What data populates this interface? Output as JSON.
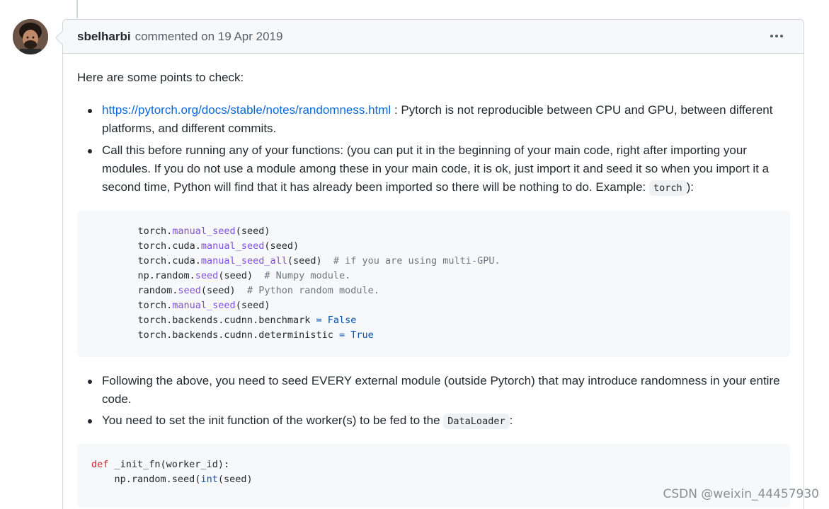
{
  "comment": {
    "author": "sbelharbi",
    "meta": "commented on 19 Apr 2019",
    "intro": "Here are some points to check:",
    "bullets": [
      {
        "link": "https://pytorch.org/docs/stable/notes/randomness.html",
        "text": " : Pytorch is not reproducible between CPU and GPU, between different platforms, and different commits."
      },
      {
        "text_before": "Call this before running any of your functions: (you can put it in the beginning of your main code, right after importing your modules. If you do not use a module among these in your main code, it is ok, just import it and seed it so when you import it a second time, Python will find that it has already been imported so there will be nothing to do. Example: ",
        "code": "torch",
        "text_after": "):"
      },
      {
        "text": "Following the above, you need to seed EVERY external module (outside Pytorch) that may introduce randomness in your entire code."
      },
      {
        "text_before": "You need to set the init function of the worker(s) to be fed to the ",
        "code": "DataLoader",
        "text_after": ":"
      }
    ],
    "code_block_1": [
      {
        "pre": "    torch.",
        "fn": "manual_seed",
        "post": "(seed)",
        "op": "",
        "val": "",
        "comment": ""
      },
      {
        "pre": "    torch.cuda.",
        "fn": "manual_seed",
        "post": "(seed)",
        "op": "",
        "val": "",
        "comment": ""
      },
      {
        "pre": "    torch.cuda.",
        "fn": "manual_seed_all",
        "post": "(seed)  ",
        "op": "",
        "val": "",
        "comment": "# if you are using multi-GPU."
      },
      {
        "pre": "    np.random.",
        "fn": "seed",
        "post": "(seed)  ",
        "op": "",
        "val": "",
        "comment": "# Numpy module."
      },
      {
        "pre": "    random.",
        "fn": "seed",
        "post": "(seed)  ",
        "op": "",
        "val": "",
        "comment": "# Python random module."
      },
      {
        "pre": "    torch.",
        "fn": "manual_seed",
        "post": "(seed)",
        "op": "",
        "val": "",
        "comment": ""
      },
      {
        "pre": "    torch.backends.cudnn.benchmark ",
        "fn": "",
        "post": "",
        "op": "= ",
        "val": "False",
        "comment": ""
      },
      {
        "pre": "    torch.backends.cudnn.deterministic ",
        "fn": "",
        "post": "",
        "op": "= ",
        "val": "True",
        "comment": ""
      }
    ],
    "code_block_2": {
      "line1_kw": "def",
      "line1_rest": " _init_fn(worker_id):",
      "line2_pre": "    np.random.seed(",
      "line2_builtin": "int",
      "line2_post": "(seed)"
    }
  },
  "watermark": "CSDN @weixin_44457930",
  "icons": {
    "more": "kebab-horizontal-icon"
  }
}
